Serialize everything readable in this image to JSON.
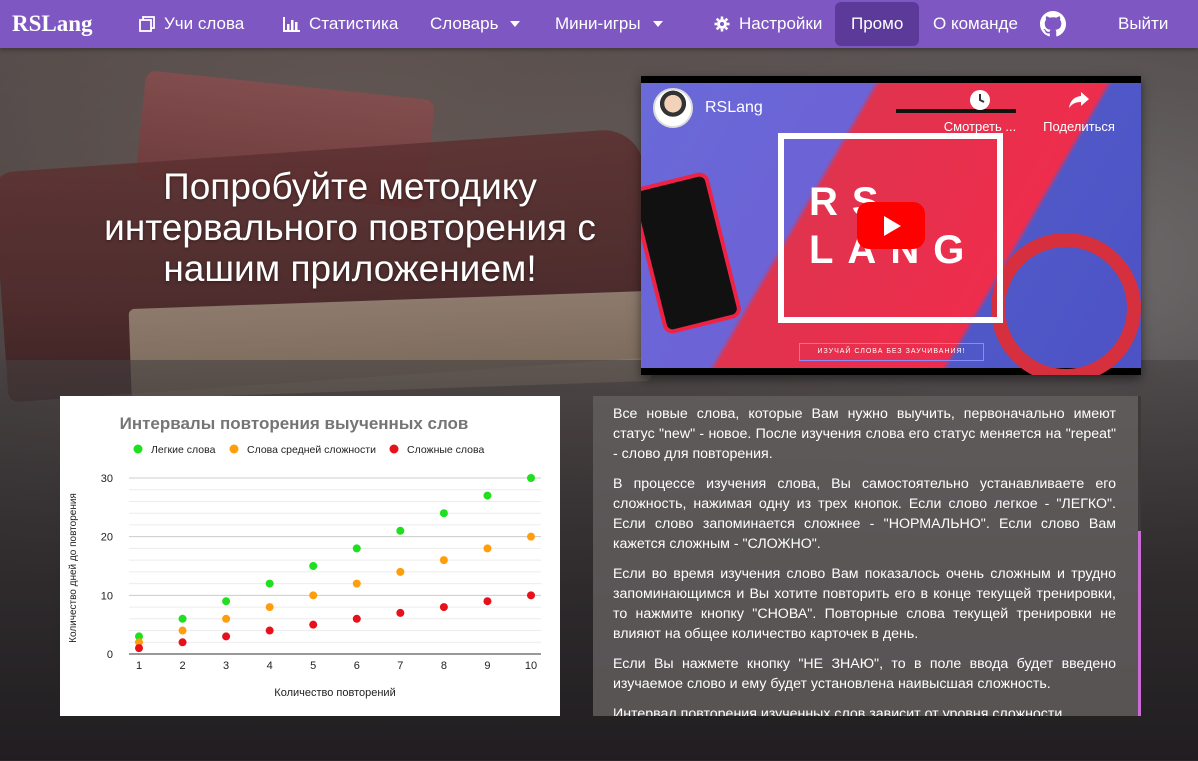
{
  "brand": "RSLang",
  "nav": {
    "learn": "Учи слова",
    "stats": "Статистика",
    "dictionary": "Словарь",
    "games": "Мини-игры",
    "settings": "Настройки",
    "promo": "Промо",
    "team": "О команде",
    "logout": "Выйти"
  },
  "hero": {
    "title": "Попробуйте методику интервального повторения с нашим приложением!"
  },
  "video": {
    "channel": "RSLang",
    "watch_later": "Смотреть ...",
    "share": "Поделиться",
    "logo_line1": "RS",
    "logo_line2": "LANG",
    "strip_text": "ИЗУЧАЙ СЛОВА БЕЗ ЗАУЧИВАНИЯ!"
  },
  "chart_data": {
    "type": "scatter",
    "title": "Интервалы повторения выученных слов",
    "xlabel": "Количество повторений",
    "ylabel": "Количество дней до повторения",
    "x": [
      1,
      2,
      3,
      4,
      5,
      6,
      7,
      8,
      9,
      10
    ],
    "xlim": [
      1,
      10
    ],
    "ylim": [
      0,
      30
    ],
    "yticks": [
      0,
      10,
      20,
      30
    ],
    "legend_position": "top",
    "grid": true,
    "series": [
      {
        "name": "Легкие слова",
        "color": "#1fe01f",
        "values": [
          3,
          6,
          9,
          12,
          15,
          18,
          21,
          24,
          27,
          30
        ]
      },
      {
        "name": "Слова средней сложности",
        "color": "#ff9e0d",
        "values": [
          2,
          4,
          6,
          8,
          10,
          12,
          14,
          16,
          18,
          20
        ]
      },
      {
        "name": "Сложные слова",
        "color": "#e8111b",
        "values": [
          1,
          2,
          3,
          4,
          5,
          6,
          7,
          8,
          9,
          10
        ]
      }
    ]
  },
  "info": {
    "p1": "Все новые слова, которые Вам нужно выучить, первоначально имеют статус \"new\" - новое. После изучения слова его статус меняется на \"repeat\" - слово для повторения.",
    "p2": "В процессе изучения слова, Вы самостоятельно устанавливаете его сложность, нажимая одну из трех кнопок. Если слово легкое - \"ЛЕГКО\". Если слово запоминается сложнее - \"НОРМАЛЬНО\". Если слово Вам кажется сложным - \"СЛОЖНО\".",
    "p3": "Если во время изучения слово Вам показалось очень сложным и трудно запоминающимся и Вы хотите повторить его в конце текущей тренировки, то нажмите кнопку \"СНОВА\". Повторные слова текущей тренировки не влияют на общее количество карточек в день.",
    "p4": "Если Вы нажмете кнопку \"НЕ ЗНАЮ\", то в поле ввода будет введено изучаемое слово и ему будет установлена наивысшая сложность.",
    "p5": "Интервал повторения изученных слов зависит от уровня сложности"
  }
}
